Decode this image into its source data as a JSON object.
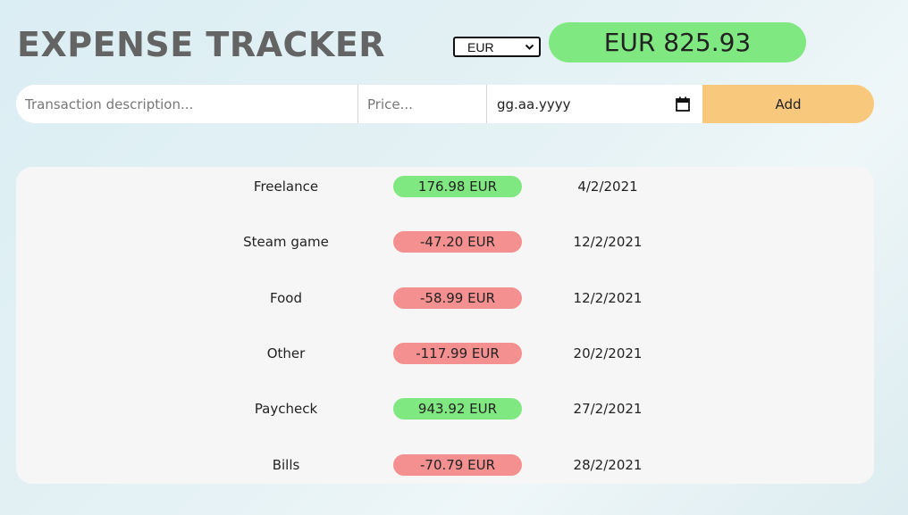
{
  "header": {
    "title": "EXPENSE TRACKER",
    "currency_selected": "EUR",
    "balance": "EUR 825.93"
  },
  "form": {
    "description_placeholder": "Transaction description...",
    "price_placeholder": "Price...",
    "date_placeholder": "gg.aa.yyyy",
    "add_label": "Add"
  },
  "colors": {
    "positive": "#80e880",
    "negative": "#f59090",
    "add_button": "#f8c87c"
  },
  "transactions": [
    {
      "description": "Freelance",
      "amount": "176.98 EUR",
      "date": "4/2/2021",
      "type": "income"
    },
    {
      "description": "Steam game",
      "amount": "-47.20 EUR",
      "date": "12/2/2021",
      "type": "expense"
    },
    {
      "description": "Food",
      "amount": "-58.99 EUR",
      "date": "12/2/2021",
      "type": "expense"
    },
    {
      "description": "Other",
      "amount": "-117.99 EUR",
      "date": "20/2/2021",
      "type": "expense"
    },
    {
      "description": "Paycheck",
      "amount": "943.92 EUR",
      "date": "27/2/2021",
      "type": "income"
    },
    {
      "description": "Bills",
      "amount": "-70.79 EUR",
      "date": "28/2/2021",
      "type": "expense"
    }
  ]
}
